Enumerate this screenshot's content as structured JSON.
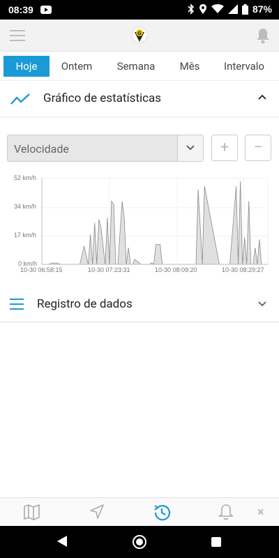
{
  "status_bar": {
    "time": "08:39",
    "battery": "87%"
  },
  "app_bar": {
    "menu_icon": "hamburger-icon",
    "logo": "app-logo",
    "notifications_icon": "bell-icon"
  },
  "tabs": [
    {
      "label": "Hoje",
      "active": true
    },
    {
      "label": "Ontem",
      "active": false
    },
    {
      "label": "Semana",
      "active": false
    },
    {
      "label": "Mês",
      "active": false
    },
    {
      "label": "Intervalo",
      "active": false
    }
  ],
  "stats_section": {
    "title": "Gráfico de estatísticas",
    "icon": "trend-line-icon",
    "expanded": true
  },
  "metric_select": {
    "value": "Velocidade",
    "zoom_in": "+",
    "zoom_out": "−"
  },
  "chart_data": {
    "type": "area",
    "y_ticks": [
      "52 km/h",
      "34 km/h",
      "17 km/h",
      "0 km/h"
    ],
    "x_ticks": [
      "10-30 06:58:15",
      "10-30 07:23:31",
      "10-30 08:09:20",
      "10-30 08:29:27"
    ],
    "ylim": [
      0,
      52
    ],
    "grid": true,
    "fill_color": "#e0e0e0",
    "line_color": "#8a8a8a",
    "series": [
      {
        "x_minutes_from_start": [
          0,
          3,
          5,
          7,
          9,
          14,
          18,
          20,
          22,
          23,
          24,
          25,
          26,
          27,
          28,
          30,
          31,
          32,
          33,
          34,
          35,
          36,
          38,
          39,
          40,
          41,
          42,
          43,
          44,
          47,
          48,
          51,
          52,
          53,
          54,
          56,
          57,
          59,
          60,
          61,
          63,
          72,
          73,
          74,
          76,
          77,
          84,
          85,
          89,
          92,
          93,
          94,
          95,
          96,
          97,
          98,
          99,
          100,
          101,
          102,
          103,
          104,
          106,
          107
        ],
        "y": [
          0,
          0,
          0.8,
          0.8,
          0,
          0,
          0,
          11,
          0,
          18,
          0,
          25,
          0,
          27,
          22,
          0,
          28,
          0,
          38,
          36,
          0,
          0,
          38,
          28,
          0,
          10,
          0,
          0,
          3,
          0,
          0,
          0,
          1,
          0,
          12,
          12,
          0,
          0,
          0,
          0,
          0,
          0,
          0,
          45,
          0,
          47,
          0,
          0,
          0,
          47,
          0,
          50,
          0,
          16,
          0,
          38,
          0,
          0,
          10,
          0,
          15,
          0,
          0,
          0
        ]
      }
    ]
  },
  "data_log_section": {
    "title": "Registro de dados",
    "icon": "list-icon",
    "expanded": false
  },
  "bottom_nav": [
    {
      "name": "map",
      "icon": "map-icon"
    },
    {
      "name": "navigation",
      "icon": "navigation-arrow-icon"
    },
    {
      "name": "history",
      "icon": "history-clock-icon",
      "active": true
    },
    {
      "name": "alerts",
      "icon": "bell-icon"
    },
    {
      "name": "close",
      "icon": "close-icon",
      "label": "×"
    }
  ],
  "colors": {
    "accent": "#1b9ad6",
    "tab_active_text": "#ffffff"
  }
}
